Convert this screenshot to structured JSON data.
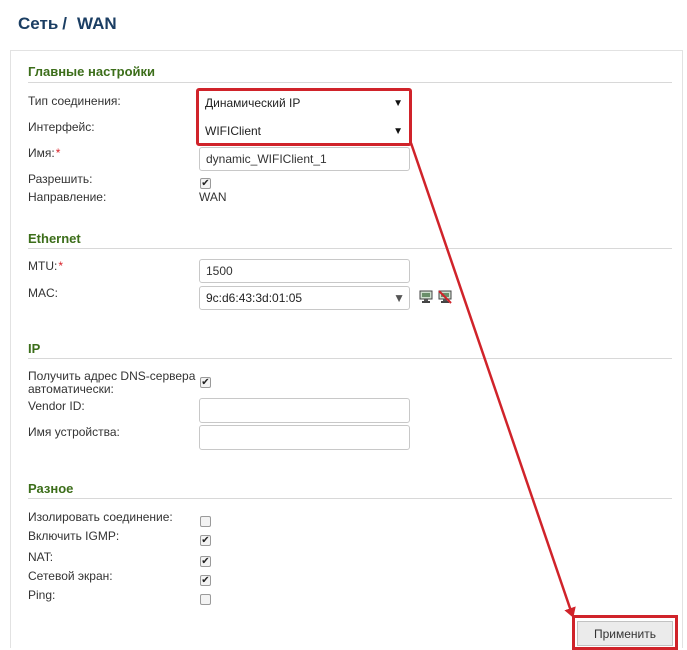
{
  "breadcrumb": {
    "network": "Сеть",
    "separator": "/",
    "page": "WAN"
  },
  "sections": {
    "main": "Главные настройки",
    "ethernet": "Ethernet",
    "ip": "IP",
    "misc": "Разное"
  },
  "main": {
    "connection_type_label": "Тип соединения:",
    "connection_type_value": "Динамический IP",
    "interface_label": "Интерфейс:",
    "interface_value": "WIFIClient",
    "name_label": "Имя:",
    "name_value": "dynamic_WIFIClient_1",
    "enable_label": "Разрешить:",
    "enable_checked": true,
    "direction_label": "Направление:",
    "direction_value": "WAN"
  },
  "ethernet": {
    "mtu_label": "MTU:",
    "mtu_value": "1500",
    "mac_label": "MAC:",
    "mac_value": "9c:d6:43:3d:01:05"
  },
  "ip": {
    "dns_auto_label_1": "Получить адрес DNS-сервера",
    "dns_auto_label_2": "автоматически:",
    "dns_auto_checked": true,
    "vendor_id_label": "Vendor ID:",
    "vendor_id_value": "",
    "device_name_label": "Имя устройства:",
    "device_name_value": ""
  },
  "misc": {
    "isolate_label": "Изолировать соединение:",
    "isolate_checked": false,
    "igmp_label": "Включить IGMP:",
    "igmp_checked": true,
    "nat_label": "NAT:",
    "nat_checked": true,
    "firewall_label": "Сетевой экран:",
    "firewall_checked": true,
    "ping_label": "Ping:",
    "ping_checked": false
  },
  "required_mark": "*",
  "apply_label": "Применить",
  "icons": {
    "dropdown": "triangle-down",
    "check": "✔",
    "mac_clone": "computer-icon",
    "mac_reset": "computer-crossed-icon"
  },
  "colors": {
    "section_title": "#3c6e1a",
    "breadcrumb": "#1b3e63",
    "highlight": "#d0232a",
    "required": "#d8232a"
  }
}
